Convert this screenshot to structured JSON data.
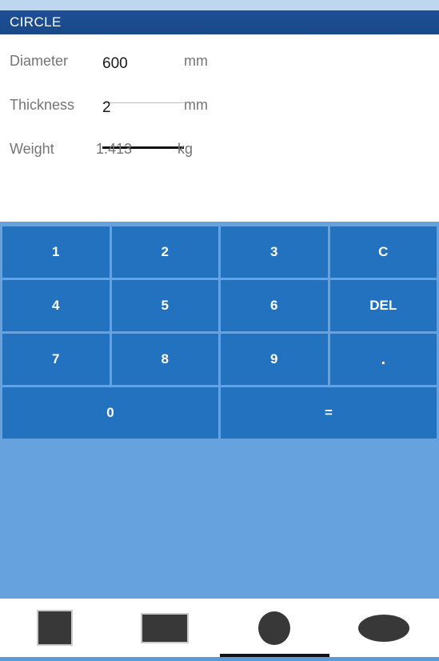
{
  "app": {
    "title": "CIRCLE"
  },
  "colors": {
    "status_strip": "#bdd7f0",
    "title_bar": "#1b4b8f",
    "keypad_background": "#66a3de",
    "key_fill": "#2272c0",
    "key_text": "#ffffff",
    "label_text": "#757575",
    "active_underline": "#111111",
    "idle_underline": "#bdbdbd",
    "shape_icon": "#383838",
    "bottom_edge": "#5b9bd5"
  },
  "form": {
    "rows": [
      {
        "label": "Diameter",
        "value": "600",
        "unit": "mm",
        "focused": false,
        "readonly": false
      },
      {
        "label": "Thickness",
        "value": "2",
        "unit": "mm",
        "focused": true,
        "readonly": false
      },
      {
        "label": "Weight",
        "value": "1.413",
        "unit": "kg",
        "focused": false,
        "readonly": true
      }
    ]
  },
  "keypad": {
    "keys": [
      {
        "label": "1",
        "name": "key-1",
        "wide": false
      },
      {
        "label": "2",
        "name": "key-2",
        "wide": false
      },
      {
        "label": "3",
        "name": "key-3",
        "wide": false
      },
      {
        "label": "C",
        "name": "key-clear",
        "wide": false
      },
      {
        "label": "4",
        "name": "key-4",
        "wide": false
      },
      {
        "label": "5",
        "name": "key-5",
        "wide": false
      },
      {
        "label": "6",
        "name": "key-6",
        "wide": false
      },
      {
        "label": "DEL",
        "name": "key-delete",
        "wide": false
      },
      {
        "label": "7",
        "name": "key-7",
        "wide": false
      },
      {
        "label": "8",
        "name": "key-8",
        "wide": false
      },
      {
        "label": "9",
        "name": "key-9",
        "wide": false
      },
      {
        "label": ".",
        "name": "key-decimal",
        "wide": false
      },
      {
        "label": "0",
        "name": "key-0",
        "wide": true
      },
      {
        "label": "=",
        "name": "key-equals",
        "wide": true
      }
    ]
  },
  "tab_bar": {
    "tabs": [
      {
        "name": "tab-square",
        "icon": "square-icon",
        "shape": "square",
        "selected": false
      },
      {
        "name": "tab-rectangle",
        "icon": "rectangle-icon",
        "shape": "rect",
        "selected": false
      },
      {
        "name": "tab-circle",
        "icon": "circle-icon",
        "shape": "circle",
        "selected": true
      },
      {
        "name": "tab-ellipse",
        "icon": "ellipse-icon",
        "shape": "ellipse",
        "selected": false
      }
    ]
  }
}
